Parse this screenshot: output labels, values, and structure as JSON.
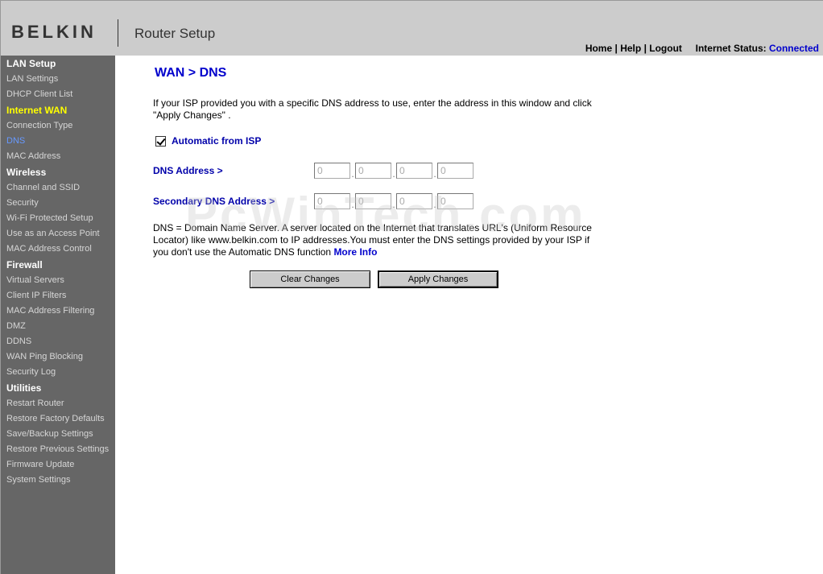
{
  "header": {
    "logo": "BELKIN",
    "app_title": "Router Setup",
    "links": {
      "home": "Home",
      "help": "Help",
      "logout": "Logout"
    },
    "status_label": "Internet Status:",
    "status_value": "Connected"
  },
  "sidebar": {
    "sections": [
      {
        "title": "LAN Setup",
        "items": [
          "LAN Settings",
          "DHCP Client List"
        ]
      },
      {
        "title": "Internet WAN",
        "items": [
          "Connection Type",
          "DNS",
          "MAC Address"
        ]
      },
      {
        "title": "Wireless",
        "items": [
          "Channel and SSID",
          "Security",
          "Wi-Fi Protected Setup",
          "Use as an Access Point",
          "MAC Address Control"
        ]
      },
      {
        "title": "Firewall",
        "items": [
          "Virtual Servers",
          "Client IP Filters",
          "MAC Address Filtering",
          "DMZ",
          "DDNS",
          "WAN Ping Blocking",
          "Security Log"
        ]
      },
      {
        "title": "Utilities",
        "items": [
          "Restart Router",
          "Restore Factory Defaults",
          "Save/Backup Settings",
          "Restore Previous Settings",
          "Firmware Update",
          "System Settings"
        ]
      }
    ]
  },
  "main": {
    "title": "WAN > DNS",
    "intro": "If your ISP provided you with a specific DNS address to use, enter the address in this window and click \"Apply Changes\" .",
    "auto_label": "Automatic from ISP",
    "dns_label": "DNS Address >",
    "secondary_label": "Secondary DNS Address >",
    "dns_octets": [
      "0",
      "0",
      "0",
      "0"
    ],
    "secondary_octets": [
      "0",
      "0",
      "0",
      "0"
    ],
    "ip_separator": ".",
    "description": "DNS = Domain Name Server. A server located on the Internet that translates URL's (Uniform Resource Locator) like www.belkin.com to IP addresses.You must enter the DNS settings provided by your ISP if you don't use the Automatic DNS function",
    "more_info": "More Info",
    "clear_button": "Clear Changes",
    "apply_button": "Apply Changes"
  },
  "watermark": "PcWinTech.com"
}
